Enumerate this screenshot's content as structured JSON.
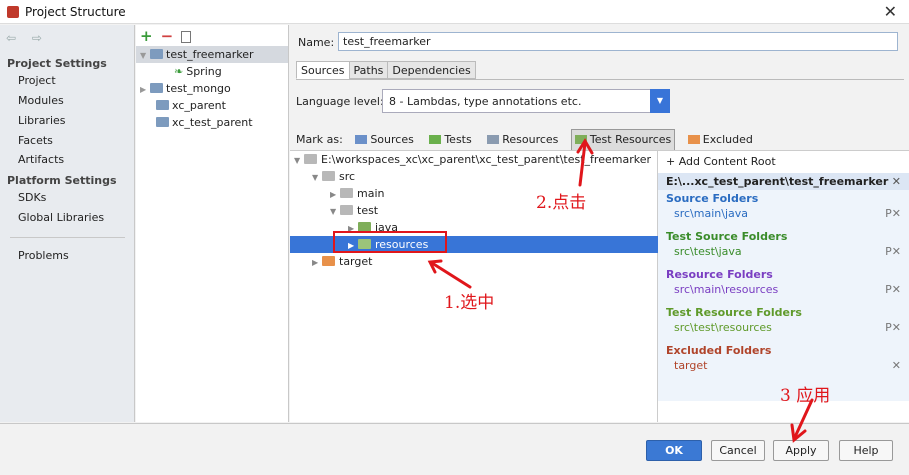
{
  "window": {
    "title": "Project Structure",
    "close_glyph": "✕"
  },
  "nav": {
    "arrows": "⇦ ⇨",
    "project_settings_header": "Project Settings",
    "project_settings": [
      "Project",
      "Modules",
      "Libraries",
      "Facets",
      "Artifacts"
    ],
    "platform_settings_header": "Platform Settings",
    "platform_settings": [
      "SDKs",
      "Global Libraries"
    ],
    "problems": "Problems"
  },
  "modules": {
    "toolbar": {
      "add": "+",
      "remove": "−"
    },
    "items": [
      {
        "label": "test_freemarker",
        "selected": true,
        "expanded": true
      },
      {
        "label": "Spring",
        "child": true
      },
      {
        "label": "test_mongo",
        "expanded": false
      },
      {
        "label": "xc_parent"
      },
      {
        "label": "xc_test_parent"
      }
    ]
  },
  "main": {
    "name_label": "Name:",
    "name_value": "test_freemarker",
    "tabs": [
      "Sources",
      "Paths",
      "Dependencies"
    ],
    "active_tab": "Sources",
    "language_level_label": "Language level:",
    "language_level_value": "8 - Lambdas, type annotations etc.",
    "mark_as_label": "Mark as:",
    "mark_as": [
      {
        "label": "Sources",
        "color": "#6b90c9"
      },
      {
        "label": "Tests",
        "color": "#6ab04c"
      },
      {
        "label": "Resources",
        "color": "#8a9bb0"
      },
      {
        "label": "Test Resources",
        "color": "#7fae5a",
        "pressed": true
      },
      {
        "label": "Excluded",
        "color": "#e8914a"
      }
    ],
    "tree": [
      {
        "label": "E:\\workspaces_xc\\xc_parent\\xc_test_parent\\test_freemarker",
        "depth": 0,
        "expanded": true
      },
      {
        "label": "src",
        "depth": 1,
        "expanded": true
      },
      {
        "label": "main",
        "depth": 2,
        "expanded": false
      },
      {
        "label": "test",
        "depth": 2,
        "expanded": true
      },
      {
        "label": "java",
        "depth": 3,
        "expanded": false
      },
      {
        "label": "resources",
        "depth": 3,
        "expanded": false,
        "selected": true
      },
      {
        "label": "target",
        "depth": 1,
        "expanded": false
      }
    ],
    "content_roots": {
      "add_label": "+ Add Content Root",
      "root_path": "E:\\...xc_test_parent\\test_freemarker",
      "groups": [
        {
          "header": "Source Folders",
          "path": "src\\main\\java",
          "color": "#2a6cc1"
        },
        {
          "header": "Test Source Folders",
          "path": "src\\test\\java",
          "color": "#3a8c2a"
        },
        {
          "header": "Resource Folders",
          "path": "src\\main\\resources",
          "color": "#7a3ec2"
        },
        {
          "header": "Test Resource Folders",
          "path": "src\\test\\resources",
          "color": "#5f9a2a"
        },
        {
          "header": "Excluded Folders",
          "path": "target",
          "color": "#b0442a"
        }
      ]
    }
  },
  "buttons": {
    "ok": "OK",
    "cancel": "Cancel",
    "apply": "Apply",
    "help": "Help"
  },
  "annotations": {
    "step1": "1.选中",
    "step2": "2.点击",
    "step3": "3 应用"
  }
}
